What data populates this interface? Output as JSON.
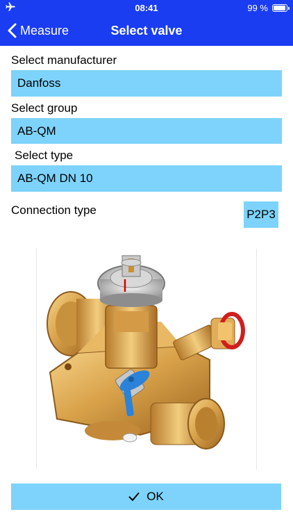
{
  "status": {
    "time": "08:41",
    "battery": "99 %",
    "icons": [
      "airplane-icon",
      "battery-icon"
    ]
  },
  "nav": {
    "back_label": "Measure",
    "title": "Select valve",
    "icons": [
      "chevron-left-icon"
    ]
  },
  "form": {
    "manufacturer": {
      "label": "Select manufacturer",
      "value": "Danfoss"
    },
    "group": {
      "label": "Select group",
      "value": "AB-QM"
    },
    "type": {
      "label": "Select type",
      "value": "AB-QM DN 10"
    },
    "connection": {
      "label": "Connection type",
      "value": "P2P3"
    }
  },
  "ok_button": {
    "label": "OK",
    "icon": "checkmark-icon"
  },
  "colors": {
    "accent": "#1a3df2",
    "field_bg": "#7dd3fb"
  }
}
